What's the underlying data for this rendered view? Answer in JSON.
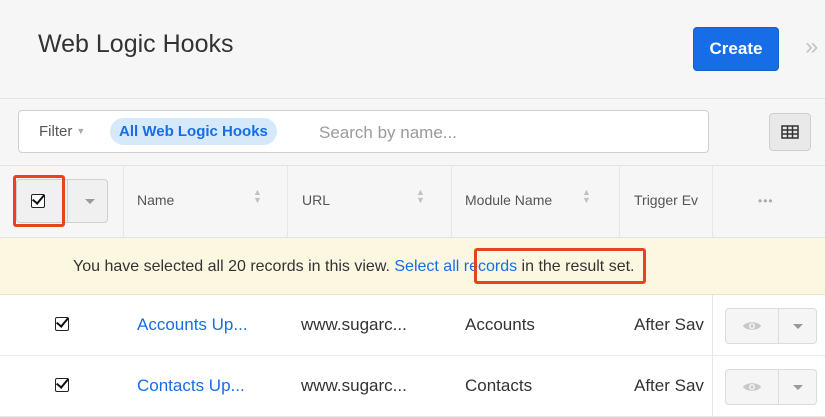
{
  "header": {
    "title": "Web Logic Hooks",
    "create_label": "Create",
    "expand_glyph": "»"
  },
  "filter": {
    "label": "Filter",
    "active_filter": "All Web Logic Hooks",
    "search_placeholder": "Search by name..."
  },
  "columns": [
    {
      "label": "Name"
    },
    {
      "label": "URL"
    },
    {
      "label": "Module Name"
    },
    {
      "label": "Trigger Ev"
    }
  ],
  "notice": {
    "before": "You have selected all 20 records in this view. ",
    "link": "Select all records",
    "after": " in the result set."
  },
  "rows": [
    {
      "name": "Accounts Up...",
      "url": "www.sugarc...",
      "module": "Accounts",
      "trigger": "After Sav",
      "checked": true
    },
    {
      "name": "Contacts Up...",
      "url": "www.sugarc...",
      "module": "Contacts",
      "trigger": "After Sav",
      "checked": true
    }
  ],
  "icons": {
    "grid": "grid-icon",
    "more": "ellipsis-icon",
    "preview": "eye-icon",
    "sort": "sort-icon"
  },
  "colors": {
    "accent": "#176de5",
    "highlight": "#e8421f",
    "notice_bg": "#fcf7e1",
    "pill_bg": "#d6e9fb"
  }
}
